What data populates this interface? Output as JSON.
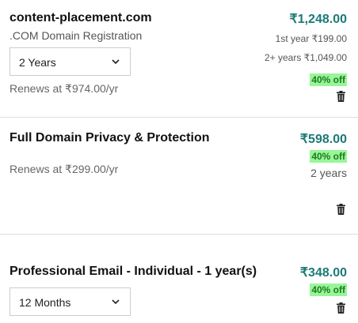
{
  "items": [
    {
      "title": "content-placement.com",
      "subtitle": ".COM Domain Registration",
      "term_select": "2 Years",
      "renews": "Renews at ₹974.00/yr",
      "price": "₹1,248.00",
      "first_year": "1st year ₹199.00",
      "later_years": "2+ years ₹1,049.00",
      "discount": "40% off"
    },
    {
      "title": "Full Domain Privacy & Protection",
      "renews": "Renews at ₹299.00/yr",
      "price": "₹598.00",
      "discount": "40% off",
      "term": "2 years"
    },
    {
      "title": "Professional Email - Individual - 1 year(s)",
      "term_select": "12 Months",
      "price": "₹348.00",
      "discount": "40% off"
    }
  ],
  "colors": {
    "price": "#1b7a78",
    "discount_bg": "#98f598",
    "discount_text": "#1f7a1f"
  },
  "icons": {
    "delete": "trash-icon",
    "dropdown": "chevron-down-icon"
  }
}
